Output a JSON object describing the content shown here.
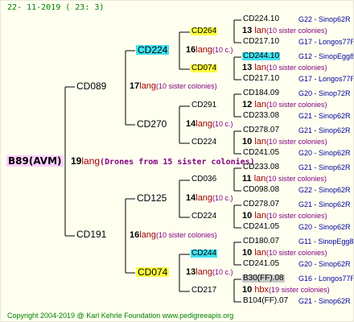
{
  "header_date": "22- 11-2019 ( 23:  3)",
  "footer": "Copyright 2004-2019 @ Karl Kehrle Foundation   www.pedigreeapis.org",
  "colors": {
    "cyan": "#40e0f0",
    "yellow": "#ffff40",
    "root_bg": "#ffd0ff",
    "gray": "#c8c8c8"
  },
  "root": {
    "label": "B89(AVM)",
    "num": "19",
    "lang": "lang",
    "sc": "(Drones from 15 sister colonies)"
  },
  "gen1": [
    {
      "label": "CD089",
      "num": "17",
      "lang": "lang",
      "sc": "(10 sister colonies)"
    },
    {
      "label": "CD191",
      "num": "16",
      "lang": "lang",
      "sc": "(10 sister colonies)"
    }
  ],
  "gen2": [
    {
      "label": "CD224",
      "num": "16",
      "lang": "lang",
      "sc": "(10 c.)"
    },
    {
      "label": "CD270",
      "num": "14",
      "lang": "lang",
      "sc": "(10 c.)"
    },
    {
      "label": "CD125",
      "num": "14",
      "lang": "lang",
      "sc": "(10 c.)"
    },
    {
      "label": "CD074",
      "num": "13",
      "lang": "lang",
      "sc": "(10 c.)"
    }
  ],
  "gen3": [
    {
      "label": "CD264"
    },
    {
      "label": "CD074"
    },
    {
      "label": "CD291"
    },
    {
      "label": "CD224"
    },
    {
      "label": "CD036"
    },
    {
      "label": "CD224"
    },
    {
      "label": "CD244"
    },
    {
      "label": "CD217"
    }
  ],
  "gen4": [
    {
      "a": "CD224.10",
      "an": "G22 - Sinop62R",
      "num": "13",
      "lang": "lan",
      "sc": "(10 sister colonies)",
      "b": "CD217.10",
      "bn": "G17 - Longos77R"
    },
    {
      "a": "CD244.10",
      "an": "G12 - SinopEgg86R",
      "num": "13",
      "lang": "lan",
      "sc": "(10 sister colonies)",
      "b": "CD217.10",
      "bn": "G17 - Longos77R"
    },
    {
      "a": "CD184.09",
      "an": "G20 - Sinop72R",
      "num": "12",
      "lang": "lan",
      "sc": "(10 sister colonies)",
      "b": "CD233.08",
      "bn": "G21 - Sinop62R"
    },
    {
      "a": "CD278.07",
      "an": "G21 - Sinop62R",
      "num": "10",
      "lang": "lan",
      "sc": "(10 sister colonies)",
      "b": "CD241.05",
      "bn": "G20 - Sinop62R"
    },
    {
      "a": "CD233.08",
      "an": "G21 - Sinop62R",
      "num": "11",
      "lang": "lan",
      "sc": "(10 sister colonies)",
      "b": "CD098.08",
      "bn": "G22 - Sinop62R"
    },
    {
      "a": "CD278.07",
      "an": "G21 - Sinop62R",
      "num": "10",
      "lang": "lan",
      "sc": "(10 sister colonies)",
      "b": "CD241.05",
      "bn": "G20 - Sinop62R"
    },
    {
      "a": "CD180.07",
      "an": "G11 - SinopEgg86R",
      "num": "10",
      "lang": "lan",
      "sc": "(10 sister colonies)",
      "b": "CD241.05",
      "bn": "G20 - Sinop62R"
    },
    {
      "a": "B30(FF).08",
      "an": "G16 - Longos77R",
      "num": "10",
      "lang": "hbx",
      "sc": "(19 sister colonies)",
      "b": "B104(FF).07",
      "bn": "G21 - Sinop62R"
    }
  ]
}
